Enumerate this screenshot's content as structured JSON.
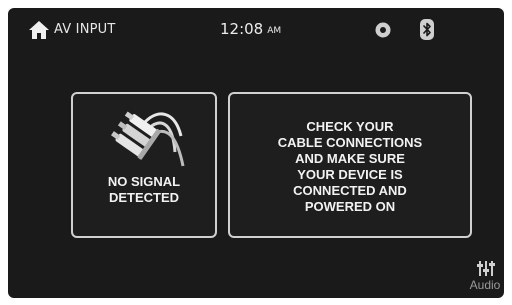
{
  "status_bar": {
    "source": "AV INPUT",
    "time": "12:08",
    "ampm": "AM",
    "icons": [
      "home-icon",
      "disc-icon",
      "bluetooth-icon"
    ]
  },
  "no_signal": {
    "icon": "cable-connector-icon",
    "text": "NO SIGNAL\nDETECTED"
  },
  "instructions": {
    "text": "CHECK YOUR\nCABLE CONNECTIONS\nAND MAKE SURE\nYOUR DEVICE IS\nCONNECTED AND\nPOWERED ON"
  },
  "audio_button": {
    "icon": "sliders-icon",
    "label": "Audio"
  },
  "colors": {
    "background": "#1a1a1a",
    "text": "#f2f2f2",
    "panel_border": "#d0d0d0",
    "muted_text": "#9a9a9a"
  }
}
